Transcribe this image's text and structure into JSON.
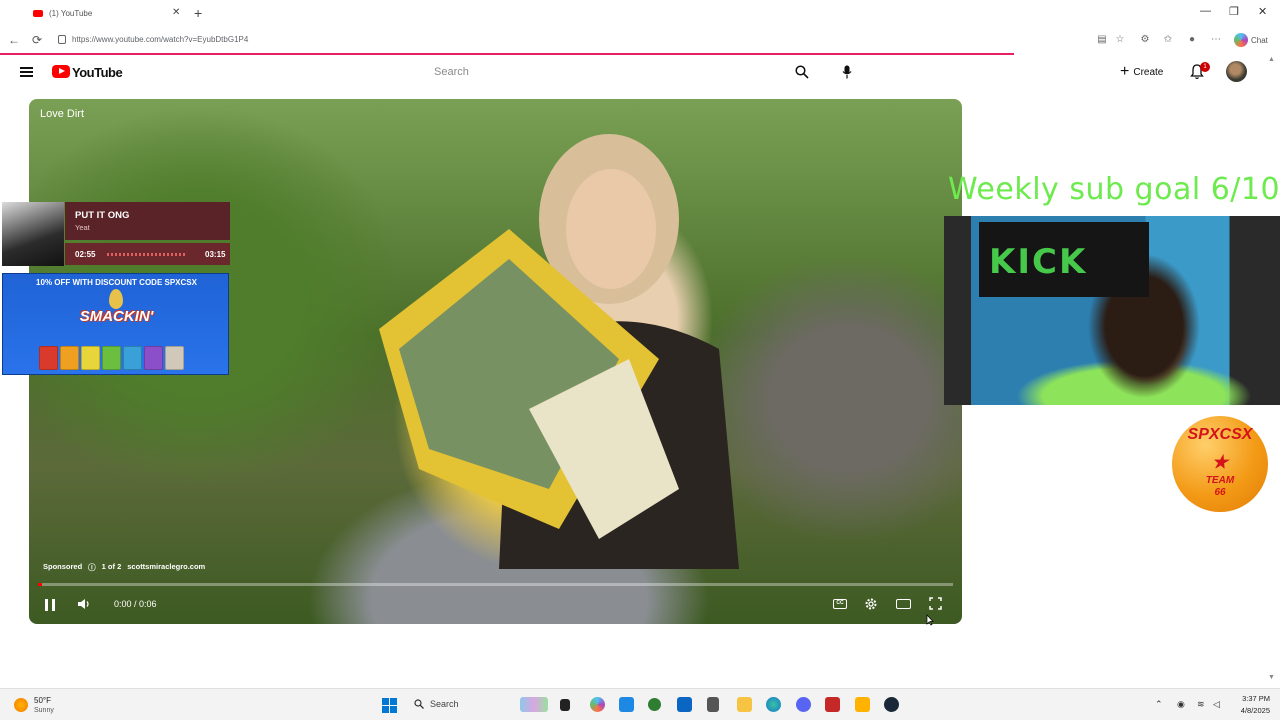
{
  "browser": {
    "tab_title": "(1) YouTube",
    "url": "https://www.youtube.com/watch?v=EyubDtbG1P4",
    "chat_label": "Chat"
  },
  "youtube": {
    "logo_text": "YouTube",
    "search_placeholder": "Search",
    "create_label": "Create",
    "notification_count": "1"
  },
  "player": {
    "title": "Love Dirt",
    "sponsored_label": "Sponsored",
    "ad_counter": "1 of 2",
    "ad_domain": "scottsmiraclegro.com",
    "time_display": "0:00 / 0:06",
    "progress_fraction": 0.003,
    "cc_label": "CC"
  },
  "music_overlay": {
    "track_title": "PUT IT ONG",
    "artist": "Yeat",
    "elapsed": "02:55",
    "total": "03:15",
    "progress_fraction": 0.9
  },
  "ad_overlay": {
    "discount_text": "10% OFF WITH DISCOUNT CODE SPXCSX",
    "brand": "SMACKIN'",
    "pack_colors": [
      "#d93a2b",
      "#f0a020",
      "#e8d53a",
      "#6cbf3e",
      "#3aa0d8",
      "#8a4fc9",
      "#d0c8b8"
    ]
  },
  "stream": {
    "sub_goal": "Weekly sub goal 6/10",
    "banner_text": "KICK",
    "badge_name": "SPXCSX",
    "badge_star": "★",
    "badge_team": "TEAM",
    "badge_number": "66"
  },
  "taskbar": {
    "weather_temp": "50°F",
    "weather_condition": "Sunny",
    "search_label": "Search",
    "time": "3:37 PM",
    "date": "4/8/2025",
    "apps": [
      "widgets",
      "file-explorer-app",
      "copilot-app",
      "store-app",
      "app-5",
      "outlook-app",
      "app-7",
      "folder-app",
      "edge-app",
      "discord-app",
      "app-11",
      "app-12",
      "steam-app"
    ]
  },
  "colors": {
    "yt_red": "#ff0000",
    "sub_goal_green": "#6dea4d",
    "loader_pink": "#e91e63"
  }
}
